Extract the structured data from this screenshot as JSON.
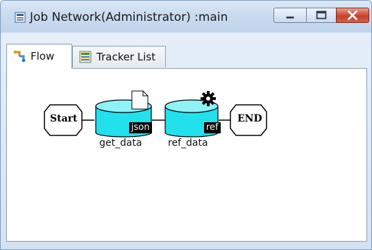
{
  "window": {
    "title": "Job Network(Administrator) :main"
  },
  "tabs": [
    {
      "label": "Flow",
      "active": true,
      "icon": "flow-icon"
    },
    {
      "label": "Tracker List",
      "active": false,
      "icon": "tracker-list-icon"
    }
  ],
  "flow": {
    "start_label": "Start",
    "end_label": "END",
    "jobs": [
      {
        "name": "get_data",
        "badge": "json",
        "icon": "document-icon"
      },
      {
        "name": "ref_data",
        "badge": "ref",
        "icon": "gear-icon"
      }
    ]
  },
  "colors": {
    "job_fill": "#22e0ec",
    "titlebar": "#c9dbef"
  }
}
